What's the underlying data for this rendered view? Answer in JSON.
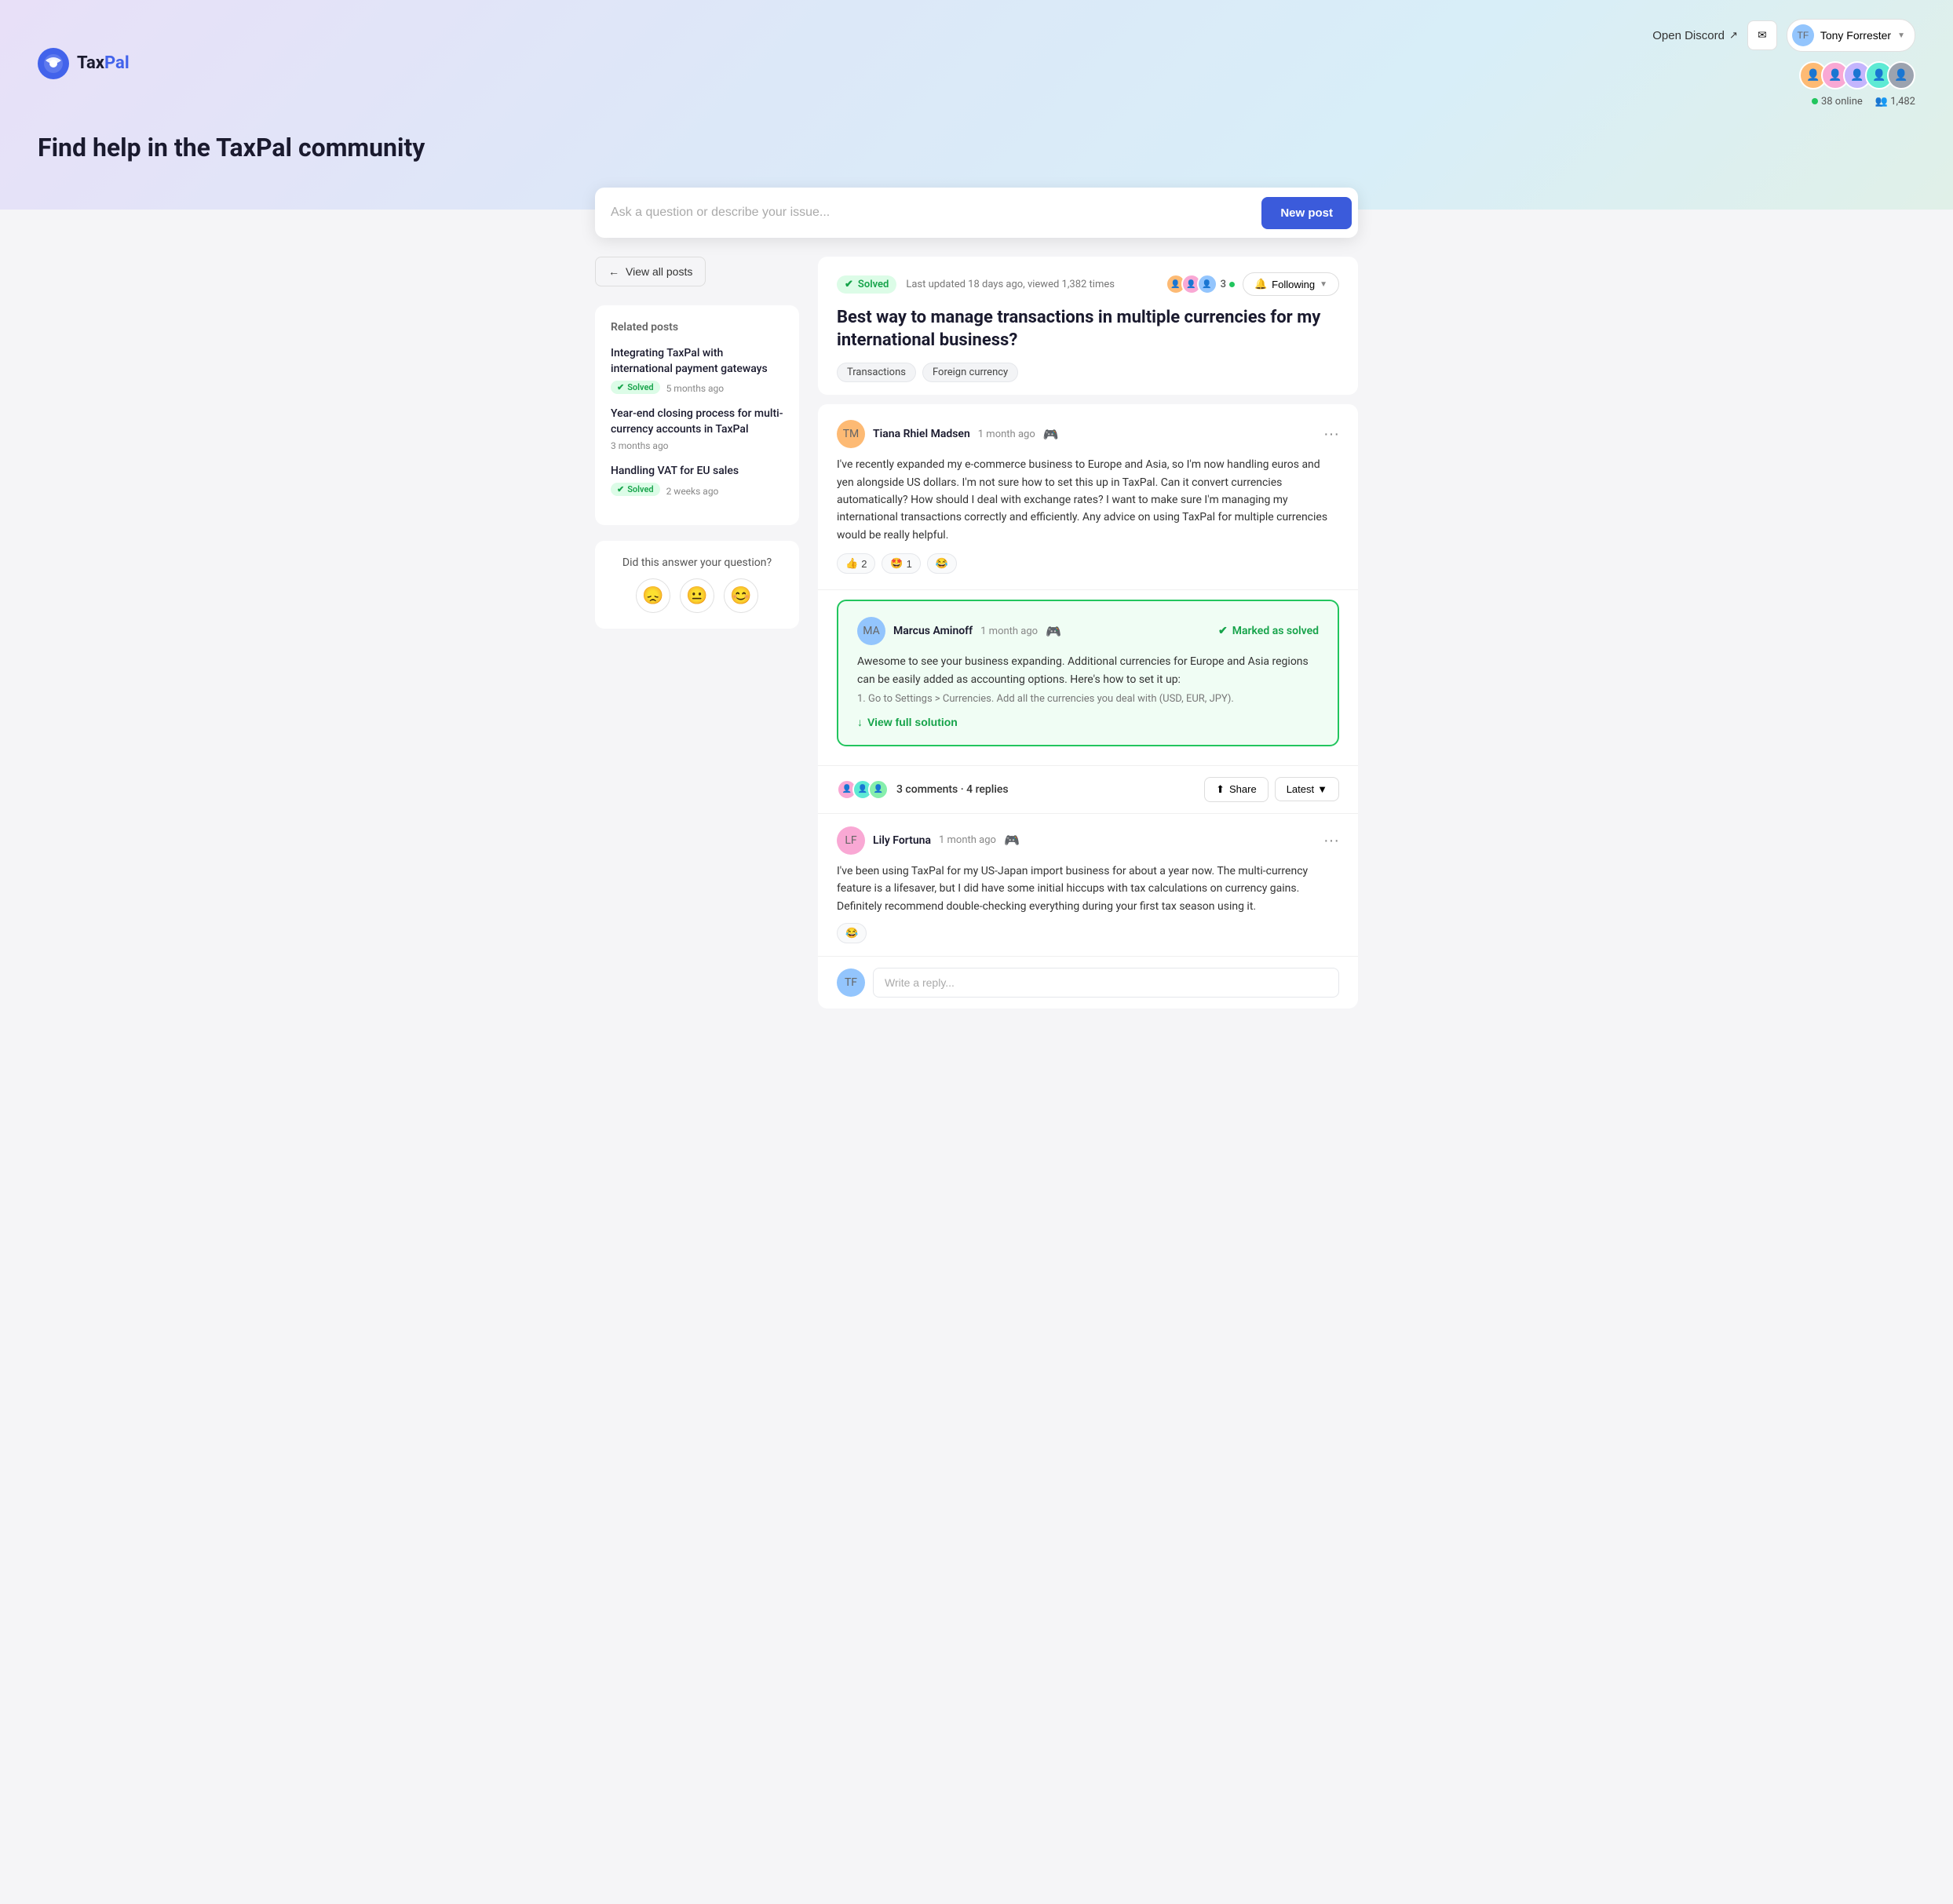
{
  "brand": {
    "tax": "Tax",
    "pal": "Pal",
    "full": "TaxPal"
  },
  "header": {
    "discord_label": "Open Discord",
    "user_name": "Tony Forrester",
    "hero_title": "Find help in the TaxPal community",
    "online_count": "38 online",
    "member_count": "1,482"
  },
  "search": {
    "placeholder": "Ask a question or describe your issue...",
    "new_post_label": "New post"
  },
  "sidebar": {
    "back_label": "View all posts",
    "related_title": "Related posts",
    "related_posts": [
      {
        "title": "Integrating TaxPal with international payment gateways",
        "solved": true,
        "time": "5 months ago"
      },
      {
        "title": "Year-end closing process for multi-currency accounts in TaxPal",
        "solved": false,
        "time": "3 months ago"
      },
      {
        "title": "Handling VAT for EU sales",
        "solved": true,
        "time": "2 weeks ago"
      }
    ],
    "satisfaction_question": "Did this answer your question?"
  },
  "post": {
    "solved_label": "Solved",
    "meta": "Last updated 18 days ago, viewed 1,382 times",
    "watcher_count": "3",
    "following_label": "Following",
    "title": "Best way to manage transactions in multiple currencies for my international business?",
    "tags": [
      "Transactions",
      "Foreign currency"
    ]
  },
  "original_post": {
    "author": "Tiana Rhiel Madsen",
    "time": "1 month ago",
    "body": "I've recently expanded my e-commerce business to Europe and Asia, so I'm now handling euros and yen alongside US dollars. I'm not sure how to set this up in TaxPal. Can it convert currencies automatically? How should I deal with exchange rates? I want to make sure I'm managing my international transactions correctly and efficiently. Any advice on using TaxPal for multiple currencies would be really helpful.",
    "reactions": [
      {
        "emoji": "👍",
        "count": "2"
      },
      {
        "emoji": "🤩",
        "count": "1"
      },
      {
        "emoji": "😂",
        "count": ""
      }
    ]
  },
  "solution": {
    "author": "Marcus Aminoff",
    "time": "1 month ago",
    "marked_as_solved": "Marked as solved",
    "body": "Awesome to see your business expanding. Additional currencies for Europe and Asia regions can be easily added as accounting options. Here's how to set it up:",
    "preview": "1. Go to Settings > Currencies. Add all the currencies you deal with (USD, EUR, JPY).",
    "view_full_label": "View full solution"
  },
  "comments": {
    "count_label": "3 comments · 4 replies",
    "share_label": "Share",
    "sort_label": "Latest",
    "items": [
      {
        "author": "Lily Fortuna",
        "time": "1 month ago",
        "body": "I've been using TaxPal for my US-Japan import business for about a year now. The multi-currency feature is a lifesaver, but I did have some initial hiccups with tax calculations on currency gains. Definitely recommend double-checking everything during your first tax season using it."
      }
    ],
    "reply_placeholder": "Write a reply..."
  },
  "emojis": {
    "sad": "😞",
    "neutral": "😐",
    "happy": "😊"
  }
}
